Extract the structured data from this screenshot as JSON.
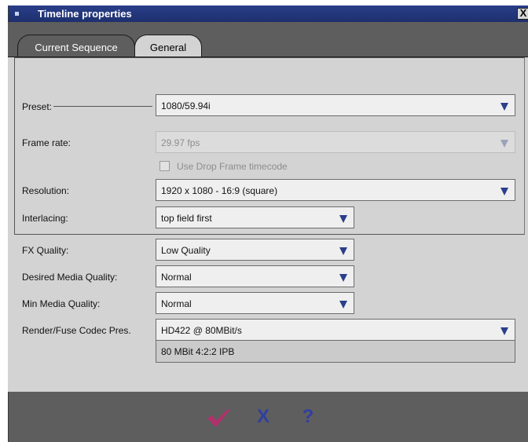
{
  "window": {
    "title": "Timeline properties",
    "close_label": "X"
  },
  "tabs": [
    {
      "label": "Current Sequence"
    },
    {
      "label": "General"
    }
  ],
  "fields": {
    "preset": {
      "label": "Preset:",
      "value": "1080/59.94i"
    },
    "frame_rate": {
      "label": "Frame rate:",
      "value": "29.97 fps"
    },
    "drop_frame": {
      "label": "Use Drop Frame timecode",
      "checked": false
    },
    "resolution": {
      "label": "Resolution:",
      "value": "1920 x 1080 - 16:9 (square)"
    },
    "interlacing": {
      "label": "Interlacing:",
      "value": "top field first"
    },
    "fx_quality": {
      "label": "FX Quality:",
      "value": "Low Quality"
    },
    "desired_media_quality": {
      "label": "Desired Media Quality:",
      "value": "Normal"
    },
    "min_media_quality": {
      "label": "Min Media Quality:",
      "value": "Normal"
    },
    "render_codec": {
      "label": "Render/Fuse Codec Pres.",
      "value": "HD422 @ 80MBit/s",
      "detail": "80 MBit 4:2:2 IPB"
    }
  },
  "footer": {
    "ok_icon": "checkmark-icon",
    "cancel_label": "X",
    "help_label": "?"
  },
  "colors": {
    "title_bar": "#2a3f8a",
    "accent": "#2f3fa0",
    "ok": "#b0306a",
    "panel": "#d3d3d3"
  }
}
